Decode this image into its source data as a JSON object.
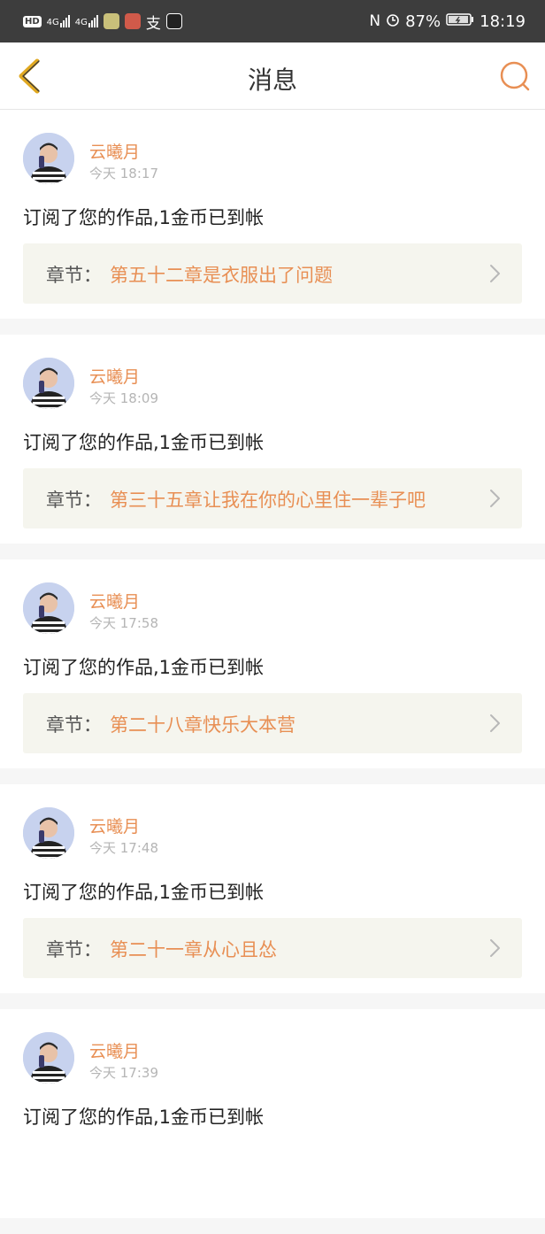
{
  "status_bar": {
    "hd": "HD",
    "net1": "4G",
    "net2": "4G",
    "alipay_glyph": "支",
    "battery": "87%",
    "time": "18:19"
  },
  "nav": {
    "title": "消息",
    "back_icon": "chevron-left-icon",
    "search_icon": "search-icon"
  },
  "colors": {
    "accent": "#e88f54",
    "back": "#e0a820",
    "chapter_bg": "#f5f5ee"
  },
  "messages": [
    {
      "user": "云曦月",
      "time": "今天 18:17",
      "text": "订阅了您的作品,1金币已到帐",
      "chapter_prefix": "章节：",
      "chapter": "第五十二章是衣服出了问题"
    },
    {
      "user": "云曦月",
      "time": "今天 18:09",
      "text": "订阅了您的作品,1金币已到帐",
      "chapter_prefix": "章节：",
      "chapter": "第三十五章让我在你的心里住一辈子吧"
    },
    {
      "user": "云曦月",
      "time": "今天 17:58",
      "text": "订阅了您的作品,1金币已到帐",
      "chapter_prefix": "章节：",
      "chapter": "第二十八章快乐大本营"
    },
    {
      "user": "云曦月",
      "time": "今天 17:48",
      "text": "订阅了您的作品,1金币已到帐",
      "chapter_prefix": "章节：",
      "chapter": "第二十一章从心且怂"
    },
    {
      "user": "云曦月",
      "time": "今天 17:39",
      "text": "订阅了您的作品,1金币已到帐"
    }
  ]
}
